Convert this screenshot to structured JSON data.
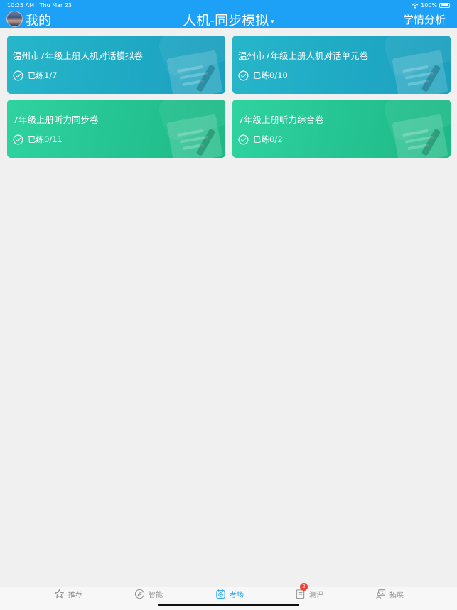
{
  "status_bar": {
    "time": "10:25 AM",
    "date": "Thu Mar 23",
    "battery": "100%"
  },
  "header": {
    "my_label": "我的",
    "title": "人机-同步模拟",
    "title_caret": "▾",
    "analysis_label": "学情分析",
    "background_color": "#1da1f7"
  },
  "cards": [
    {
      "title": "温州市7年级上册人机对话模拟卷",
      "status": "已练1/7",
      "theme": "blue"
    },
    {
      "title": "温州市7年级上册人机对话单元卷",
      "status": "已练0/10",
      "theme": "blue"
    },
    {
      "title": "7年级上册听力同步卷",
      "status": "已练0/11",
      "theme": "green"
    },
    {
      "title": "7年级上册听力综合卷",
      "status": "已练0/2",
      "theme": "green"
    }
  ],
  "tabbar": {
    "tabs": [
      {
        "label": "推荐",
        "icon": "star-icon"
      },
      {
        "label": "智能",
        "icon": "compass-icon"
      },
      {
        "label": "考场",
        "icon": "clock-calendar-icon",
        "active": true
      },
      {
        "label": "测评",
        "icon": "document-icon",
        "badge": "2"
      },
      {
        "label": "拓展",
        "icon": "person-board-icon"
      }
    ],
    "active_color": "#1da1f7"
  }
}
